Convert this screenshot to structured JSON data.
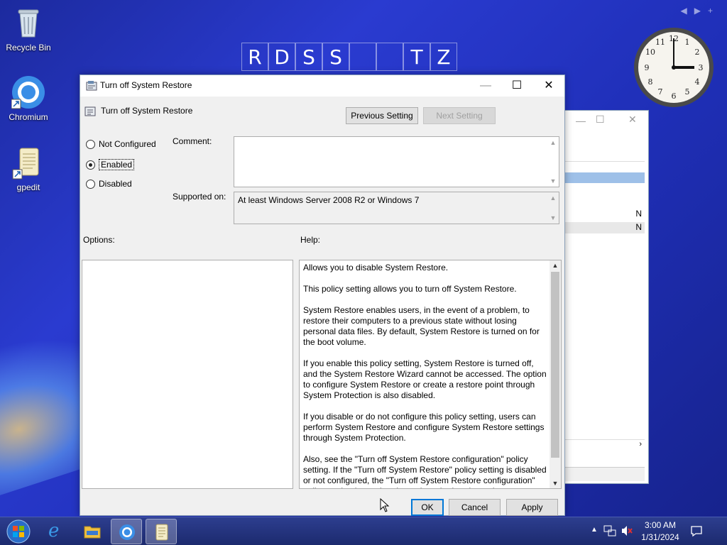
{
  "desktop": {
    "icons": [
      {
        "label": "Recycle Bin"
      },
      {
        "label": "Chromium"
      },
      {
        "label": "gpedit"
      }
    ],
    "banner_letters": [
      "R",
      "D",
      "S",
      "S",
      "",
      "",
      "T",
      "Z"
    ],
    "topnav": [
      "◀",
      "▶",
      "+"
    ]
  },
  "dialog": {
    "title": "Turn off System Restore",
    "setting_name": "Turn off System Restore",
    "prev_label": "Previous Setting",
    "next_label": "Next Setting",
    "state_options": [
      {
        "label": "Not Configured",
        "checked": false
      },
      {
        "label": "Enabled",
        "checked": true
      },
      {
        "label": "Disabled",
        "checked": false
      }
    ],
    "comment_label": "Comment:",
    "comment_value": "",
    "supported_label": "Supported on:",
    "supported_value": "At least Windows Server 2008 R2 or Windows 7",
    "options_label": "Options:",
    "help_label": "Help:",
    "help_paragraphs": [
      "Allows you to disable System Restore.",
      "This policy setting allows you to turn off System Restore.",
      "System Restore enables users, in the event of a problem, to restore their computers to a previous state without losing personal data files. By default, System Restore is turned on for the boot volume.",
      "If you enable this policy setting, System Restore is turned off, and the System Restore Wizard cannot be accessed. The option to configure System Restore or create a restore point through System Protection is also disabled.",
      "If you disable or do not configure this policy setting, users can perform System Restore and configure System Restore settings through System Protection.",
      "Also, see the \"Turn off System Restore configuration\" policy setting. If the \"Turn off System Restore\" policy setting is disabled or not configured, the \"Turn off System Restore configuration\" policy setting is used to determine whether the option to configure System Restore is available."
    ],
    "ok_label": "OK",
    "cancel_label": "Cancel",
    "apply_label": "Apply"
  },
  "background_window": {
    "values": [
      "N",
      "N"
    ]
  },
  "taskbar": {
    "time": "3:00 AM",
    "date": "1/31/2024"
  },
  "colors": {
    "desktop": "#2a3bd0",
    "accent": "#0078d7",
    "selection": "#9ec0e8"
  }
}
